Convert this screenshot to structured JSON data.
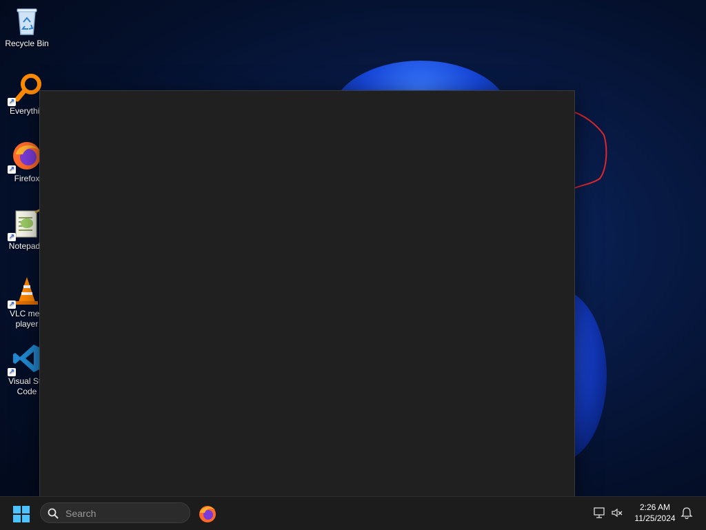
{
  "desktop": {
    "icons": [
      {
        "label": "Recycle Bin",
        "icon": "recycle-bin-icon"
      },
      {
        "label": "Everythin",
        "icon": "everything-search-icon"
      },
      {
        "label": "Firefox",
        "icon": "firefox-icon"
      },
      {
        "label": "Notepad+",
        "icon": "notepad-plus-plus-icon"
      },
      {
        "label": "VLC med",
        "label2": "player",
        "icon": "vlc-icon"
      },
      {
        "label": "Visual Stu",
        "label2": "Code",
        "icon": "vscode-icon"
      }
    ]
  },
  "taskbar": {
    "search_placeholder": "Search",
    "pinned": [
      {
        "name": "Firefox",
        "icon": "firefox-icon"
      }
    ],
    "tray": {
      "icons": [
        "network-icon",
        "volume-muted-icon",
        "notification-bell-icon"
      ]
    },
    "clock": {
      "time": "2:26 AM",
      "date": "11/25/2024"
    }
  },
  "colors": {
    "window_bg": "#202020",
    "taskbar_bg": "#1c1c1c",
    "accent": "#0078d4"
  }
}
